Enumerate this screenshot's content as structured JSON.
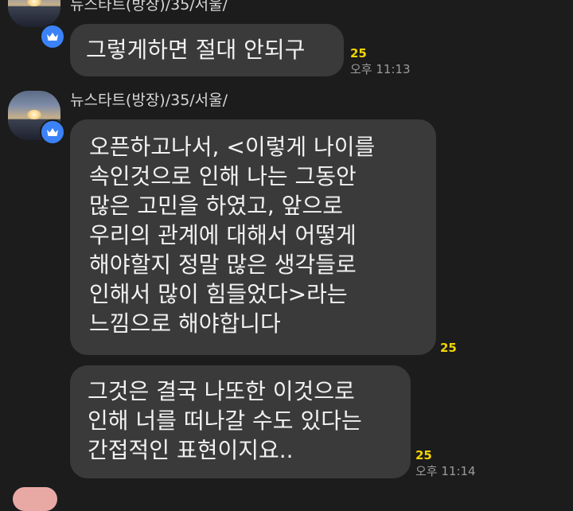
{
  "chat": {
    "groups": [
      {
        "sender": "뉴스타트(방장)/35/서울/",
        "messages": [
          {
            "text": "그렇게하면 절대 안되구",
            "unread": "25",
            "time": "오후 11:13"
          }
        ]
      },
      {
        "sender": "뉴스타트(방장)/35/서울/",
        "messages": [
          {
            "text": "오픈하고나서,    <이렇게 나이를\n속인것으로 인해 나는 그동안\n많은 고민을 하였고, 앞으로\n우리의 관계에 대해서 어떻게\n해야할지 정말 많은 생각들로\n인해서 많이 힘들었다>라는\n느낌으로 해야합니다",
            "unread": "25",
            "time": ""
          },
          {
            "text": "그것은 결국 나또한 이것으로\n인해 너를 떠나갈 수도 있다는\n간접적인 표현이지요..",
            "unread": "25",
            "time": "오후 11:14"
          }
        ]
      }
    ]
  },
  "colors": {
    "background": "#1c1c1c",
    "bubble": "#3a3a3a",
    "unread": "#f2d500",
    "crown_badge": "#3b82f6"
  },
  "icons": {
    "crown": "crown-icon"
  }
}
